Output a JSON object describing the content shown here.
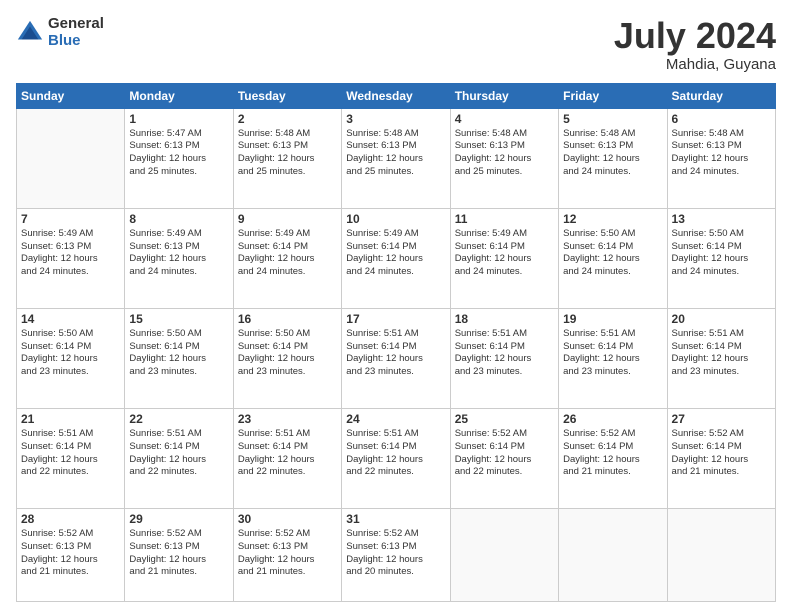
{
  "header": {
    "logo_general": "General",
    "logo_blue": "Blue",
    "month_title": "July 2024",
    "location": "Mahdia, Guyana"
  },
  "calendar": {
    "headers": [
      "Sunday",
      "Monday",
      "Tuesday",
      "Wednesday",
      "Thursday",
      "Friday",
      "Saturday"
    ],
    "rows": [
      [
        {
          "num": "",
          "info": ""
        },
        {
          "num": "1",
          "info": "Sunrise: 5:47 AM\nSunset: 6:13 PM\nDaylight: 12 hours\nand 25 minutes."
        },
        {
          "num": "2",
          "info": "Sunrise: 5:48 AM\nSunset: 6:13 PM\nDaylight: 12 hours\nand 25 minutes."
        },
        {
          "num": "3",
          "info": "Sunrise: 5:48 AM\nSunset: 6:13 PM\nDaylight: 12 hours\nand 25 minutes."
        },
        {
          "num": "4",
          "info": "Sunrise: 5:48 AM\nSunset: 6:13 PM\nDaylight: 12 hours\nand 25 minutes."
        },
        {
          "num": "5",
          "info": "Sunrise: 5:48 AM\nSunset: 6:13 PM\nDaylight: 12 hours\nand 24 minutes."
        },
        {
          "num": "6",
          "info": "Sunrise: 5:48 AM\nSunset: 6:13 PM\nDaylight: 12 hours\nand 24 minutes."
        }
      ],
      [
        {
          "num": "7",
          "info": "Sunrise: 5:49 AM\nSunset: 6:13 PM\nDaylight: 12 hours\nand 24 minutes."
        },
        {
          "num": "8",
          "info": "Sunrise: 5:49 AM\nSunset: 6:13 PM\nDaylight: 12 hours\nand 24 minutes."
        },
        {
          "num": "9",
          "info": "Sunrise: 5:49 AM\nSunset: 6:14 PM\nDaylight: 12 hours\nand 24 minutes."
        },
        {
          "num": "10",
          "info": "Sunrise: 5:49 AM\nSunset: 6:14 PM\nDaylight: 12 hours\nand 24 minutes."
        },
        {
          "num": "11",
          "info": "Sunrise: 5:49 AM\nSunset: 6:14 PM\nDaylight: 12 hours\nand 24 minutes."
        },
        {
          "num": "12",
          "info": "Sunrise: 5:50 AM\nSunset: 6:14 PM\nDaylight: 12 hours\nand 24 minutes."
        },
        {
          "num": "13",
          "info": "Sunrise: 5:50 AM\nSunset: 6:14 PM\nDaylight: 12 hours\nand 24 minutes."
        }
      ],
      [
        {
          "num": "14",
          "info": "Sunrise: 5:50 AM\nSunset: 6:14 PM\nDaylight: 12 hours\nand 23 minutes."
        },
        {
          "num": "15",
          "info": "Sunrise: 5:50 AM\nSunset: 6:14 PM\nDaylight: 12 hours\nand 23 minutes."
        },
        {
          "num": "16",
          "info": "Sunrise: 5:50 AM\nSunset: 6:14 PM\nDaylight: 12 hours\nand 23 minutes."
        },
        {
          "num": "17",
          "info": "Sunrise: 5:51 AM\nSunset: 6:14 PM\nDaylight: 12 hours\nand 23 minutes."
        },
        {
          "num": "18",
          "info": "Sunrise: 5:51 AM\nSunset: 6:14 PM\nDaylight: 12 hours\nand 23 minutes."
        },
        {
          "num": "19",
          "info": "Sunrise: 5:51 AM\nSunset: 6:14 PM\nDaylight: 12 hours\nand 23 minutes."
        },
        {
          "num": "20",
          "info": "Sunrise: 5:51 AM\nSunset: 6:14 PM\nDaylight: 12 hours\nand 23 minutes."
        }
      ],
      [
        {
          "num": "21",
          "info": "Sunrise: 5:51 AM\nSunset: 6:14 PM\nDaylight: 12 hours\nand 22 minutes."
        },
        {
          "num": "22",
          "info": "Sunrise: 5:51 AM\nSunset: 6:14 PM\nDaylight: 12 hours\nand 22 minutes."
        },
        {
          "num": "23",
          "info": "Sunrise: 5:51 AM\nSunset: 6:14 PM\nDaylight: 12 hours\nand 22 minutes."
        },
        {
          "num": "24",
          "info": "Sunrise: 5:51 AM\nSunset: 6:14 PM\nDaylight: 12 hours\nand 22 minutes."
        },
        {
          "num": "25",
          "info": "Sunrise: 5:52 AM\nSunset: 6:14 PM\nDaylight: 12 hours\nand 22 minutes."
        },
        {
          "num": "26",
          "info": "Sunrise: 5:52 AM\nSunset: 6:14 PM\nDaylight: 12 hours\nand 21 minutes."
        },
        {
          "num": "27",
          "info": "Sunrise: 5:52 AM\nSunset: 6:14 PM\nDaylight: 12 hours\nand 21 minutes."
        }
      ],
      [
        {
          "num": "28",
          "info": "Sunrise: 5:52 AM\nSunset: 6:13 PM\nDaylight: 12 hours\nand 21 minutes."
        },
        {
          "num": "29",
          "info": "Sunrise: 5:52 AM\nSunset: 6:13 PM\nDaylight: 12 hours\nand 21 minutes."
        },
        {
          "num": "30",
          "info": "Sunrise: 5:52 AM\nSunset: 6:13 PM\nDaylight: 12 hours\nand 21 minutes."
        },
        {
          "num": "31",
          "info": "Sunrise: 5:52 AM\nSunset: 6:13 PM\nDaylight: 12 hours\nand 20 minutes."
        },
        {
          "num": "",
          "info": ""
        },
        {
          "num": "",
          "info": ""
        },
        {
          "num": "",
          "info": ""
        }
      ]
    ]
  }
}
